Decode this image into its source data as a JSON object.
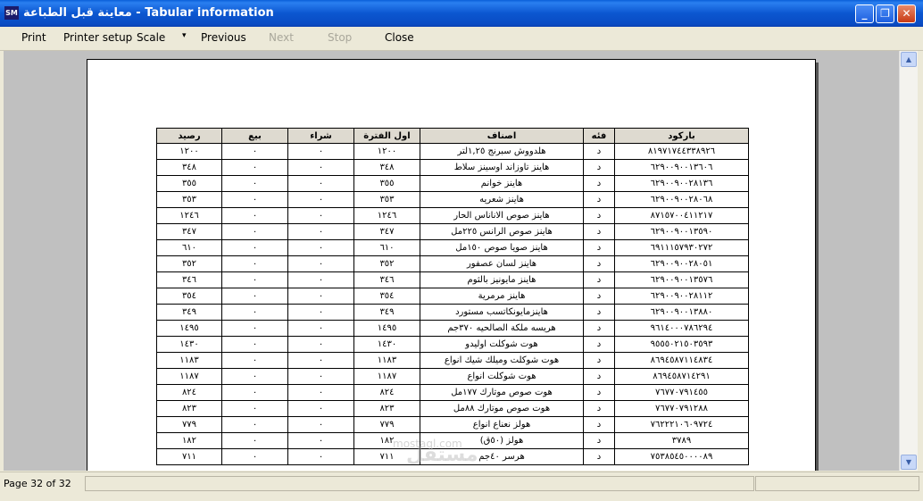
{
  "window": {
    "icon_text": "SM",
    "title": "معاينة قبل الطباعة - Tabular information",
    "minimize": "_",
    "maximize": "❐",
    "close": "✕"
  },
  "toolbar": {
    "print": "Print",
    "printer_setup": "Printer setup",
    "scale": "Scale",
    "scale_arrow": "▾",
    "previous": "Previous",
    "next": "Next",
    "stop": "Stop",
    "close": "Close"
  },
  "scrollbar": {
    "up": "▲",
    "down": "▼"
  },
  "status": {
    "page": "Page 32 of 32"
  },
  "watermark": {
    "logo": "مستقل",
    "text": "mostaql.com"
  },
  "table": {
    "headers": [
      "باركود",
      "فئه",
      "اصناف",
      "اول الفترة",
      "شراء",
      "بيع",
      "رصيد"
    ],
    "rows": [
      [
        "٨١٩٧١٧٤٤٣٣٨٩٢٦",
        "د",
        "هلدووش سبرنج ١,٢٥لتر",
        "١٢٠٠",
        "٠",
        "٠",
        "١٢٠٠"
      ],
      [
        "٦٢٩٠٠٩٠٠١٣٦٠٦",
        "د",
        "هاينز تاوزاند اوسينز سلاط",
        "٣٤٨",
        "٠",
        "٠",
        "٣٤٨"
      ],
      [
        "٦٢٩٠٠٩٠٠٢٨١٣٦",
        "د",
        "هاينز خوانم",
        "٣٥٥",
        "٠",
        "٠",
        "٣٥٥"
      ],
      [
        "٦٢٩٠٠٩٠٠٢٨٠٦٨",
        "د",
        "هاينز شعريه",
        "٣٥٣",
        "٠",
        "٠",
        "٣٥٣"
      ],
      [
        "٨٧١٥٧٠٠٤١١٢١٧",
        "د",
        "هاينز صوص الاناناس الحار",
        "١٢٤٦",
        "٠",
        "٠",
        "١٢٤٦"
      ],
      [
        "٦٢٩٠٠٩٠٠١٣٥٩٠",
        "د",
        "هاينز صوص الرانس ٢٢٥مل",
        "٣٤٧",
        "٠",
        "٠",
        "٣٤٧"
      ],
      [
        "٦٩١١١٥٧٩٣٠٢٧٢",
        "د",
        "هاينز صويا صوص ١٥٠مل",
        "٦١٠",
        "٠",
        "٠",
        "٦١٠"
      ],
      [
        "٦٢٩٠٠٩٠٠٢٨٠٥١",
        "د",
        "هاينز لسان عصفور",
        "٣٥٢",
        "٠",
        "٠",
        "٣٥٢"
      ],
      [
        "٦٢٩٠٠٩٠٠١٣٥٧٦",
        "د",
        "هاينز مايونيز بالثوم",
        "٣٤٦",
        "٠",
        "٠",
        "٣٤٦"
      ],
      [
        "٦٢٩٠٠٩٠٠٢٨١١٢",
        "د",
        "هاينز مرمرية",
        "٣٥٤",
        "٠",
        "٠",
        "٣٥٤"
      ],
      [
        "٦٢٩٠٠٩٠٠١٣٨٨٠",
        "د",
        "هاينزمايونكاتسب مستورد",
        "٣٤٩",
        "٠",
        "٠",
        "٣٤٩"
      ],
      [
        "٩٦١٤٠٠٠٧٨٦٢٩٤",
        "د",
        "هريسه ملكة الصالحيه ٣٧٠جم",
        "١٤٩٥",
        "٠",
        "٠",
        "١٤٩٥"
      ],
      [
        "٩٥٥٥٠٢١٥٠٣٥٩٣",
        "د",
        "هوت شوكلت اوليدو",
        "١٤٣٠",
        "٠",
        "٠",
        "١٤٣٠"
      ],
      [
        "٨٦٩٤٥٨٧١١٤٨٣٤",
        "د",
        "هوت شوكلت وميلك شيك انواع",
        "١١٨٣",
        "٠",
        "٠",
        "١١٨٣"
      ],
      [
        "٨٦٩٤٥٨٧١٤٢٩١",
        "د",
        "هوت شوكلت انواع",
        "١١٨٧",
        "٠",
        "٠",
        "١١٨٧"
      ],
      [
        "٧٦٧٧٠٧٩١٤٥٥",
        "د",
        "هوت صوص موتارك ١٧٧مل",
        "٨٢٤",
        "٠",
        "٠",
        "٨٢٤"
      ],
      [
        "٧٦٧٧٠٧٩١٢٨٨",
        "د",
        "هوت صوص موتارك ٨٨مل",
        "٨٢٣",
        "٠",
        "٠",
        "٨٢٣"
      ],
      [
        "٧٦٢٢٢١٠٦٠٩٧٢٤",
        "د",
        "هولز نعناع انواع",
        "٧٧٩",
        "٠",
        "٠",
        "٧٧٩"
      ],
      [
        "٣٧٨٩",
        "د",
        "هولز (٥٠ق)",
        "١٨٢",
        "٠",
        "٠",
        "١٨٢"
      ],
      [
        "٧٥٣٨٥٤٥٠٠٠٠٨٩",
        "د",
        "هرسر ٤٠جم",
        "٧١١",
        "٠",
        "٠",
        "٧١١"
      ]
    ]
  }
}
